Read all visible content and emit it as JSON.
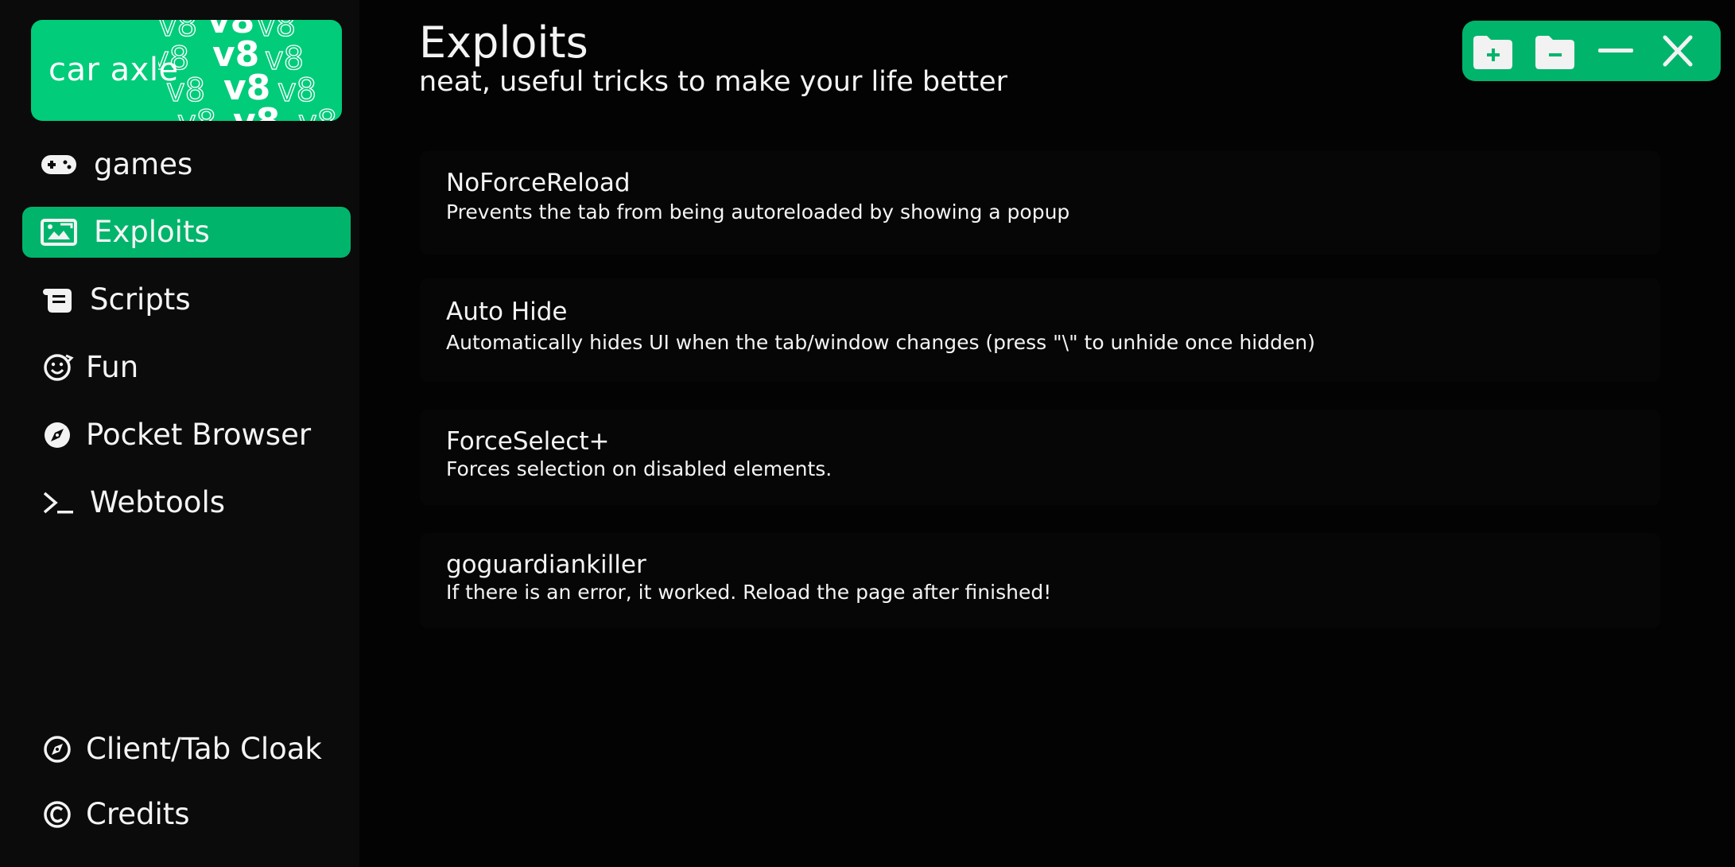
{
  "app": {
    "logo_text": "car axle",
    "logo_pattern_text": "v8",
    "accent_color": "#00b46c",
    "background_color": "#030303"
  },
  "sidebar": {
    "items": [
      {
        "label": "games",
        "icon": "gamepad-icon",
        "active": false
      },
      {
        "label": "Exploits",
        "icon": "image-exploit-icon",
        "active": true
      },
      {
        "label": "Scripts",
        "icon": "scroll-icon",
        "active": false
      },
      {
        "label": "Fun",
        "icon": "smiley-icon",
        "active": false
      },
      {
        "label": "Pocket Browser",
        "icon": "compass-icon",
        "active": false
      },
      {
        "label": "Webtools",
        "icon": "terminal-icon",
        "active": false
      }
    ],
    "bottom_items": [
      {
        "label": "Client/Tab Cloak",
        "icon": "compass-outline-icon"
      },
      {
        "label": "Credits",
        "icon": "copyright-icon"
      }
    ]
  },
  "header": {
    "title": "Exploits",
    "subtitle": "neat, useful tricks to make your life better"
  },
  "window_controls": [
    {
      "name": "add-folder-icon"
    },
    {
      "name": "remove-folder-icon"
    },
    {
      "name": "minimize-icon"
    },
    {
      "name": "close-icon"
    }
  ],
  "exploits": [
    {
      "title": "NoForceReload",
      "description": "Prevents the tab from being autoreloaded by showing a popup"
    },
    {
      "title": "Auto Hide",
      "description": "Automatically hides UI when the tab/window changes (press \"\\\" to unhide once hidden)"
    },
    {
      "title": "ForceSelect+",
      "description": "Forces selection on disabled elements."
    },
    {
      "title": "goguardiankiller",
      "description": "If there is an error, it worked. Reload the page after finished!"
    }
  ]
}
